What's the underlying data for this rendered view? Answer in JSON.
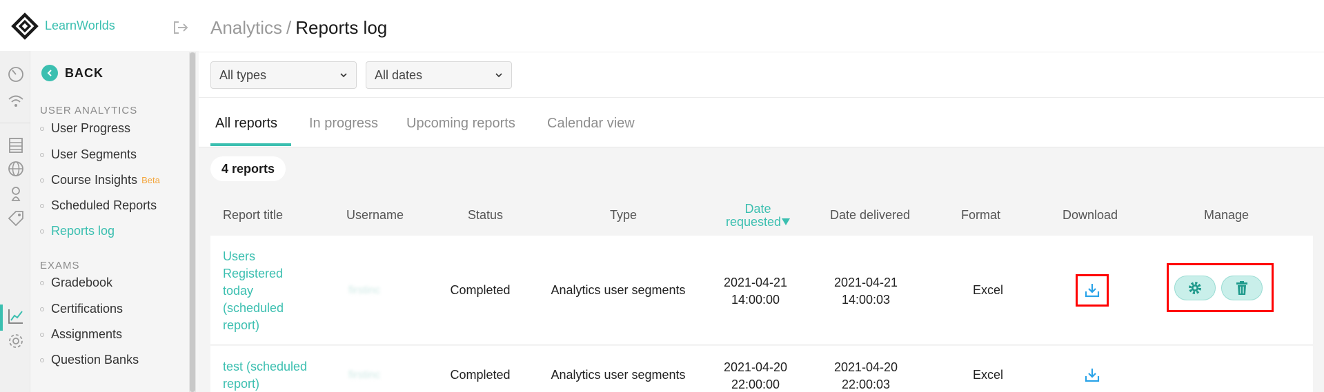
{
  "brand": {
    "name": "LearnWorlds",
    "accent": "#3bbfb0"
  },
  "sidebar": {
    "back_label": "BACK",
    "sections": [
      {
        "title": "USER ANALYTICS"
      },
      {
        "title": "EXAMS"
      }
    ],
    "items": [
      {
        "label": "User Progress"
      },
      {
        "label": "User Segments"
      },
      {
        "label": "Course Insights",
        "badge": "Beta"
      },
      {
        "label": "Scheduled Reports"
      },
      {
        "label": "Reports log"
      },
      {
        "label": "Gradebook"
      },
      {
        "label": "Certifications"
      },
      {
        "label": "Assignments"
      },
      {
        "label": "Question Banks"
      }
    ],
    "rail_icons": [
      "speedometer-icon",
      "wifi-icon",
      "document-icon",
      "globe-icon",
      "user-badge-icon",
      "tag-icon",
      "analytics-chart-icon",
      "gear-icon"
    ]
  },
  "header": {
    "parent": "Analytics",
    "separator": "/",
    "current": "Reports log"
  },
  "filters": {
    "type_value": "All types",
    "date_value": "All dates"
  },
  "tabs": [
    {
      "label": "All reports"
    },
    {
      "label": "In progress"
    },
    {
      "label": "Upcoming reports"
    },
    {
      "label": "Calendar view"
    }
  ],
  "count_label": "4 reports",
  "table": {
    "headers": {
      "title": "Report title",
      "username": "Username",
      "status": "Status",
      "type": "Type",
      "date_requested_line1": "Date",
      "date_requested_line2": "requested",
      "date_delivered": "Date delivered",
      "format": "Format",
      "download": "Download",
      "manage": "Manage"
    },
    "rows": [
      {
        "title": "Users Registered today (scheduled report)",
        "username": "firstinc",
        "status": "Completed",
        "type": "Analytics user segments",
        "requested_date": "2021-04-21",
        "requested_time": "14:00:00",
        "delivered_date": "2021-04-21",
        "delivered_time": "14:00:03",
        "format": "Excel"
      },
      {
        "title": "test (scheduled report)",
        "username": "firstinc",
        "status": "Completed",
        "type": "Analytics user segments",
        "requested_date": "2021-04-20",
        "requested_time": "22:00:00",
        "delivered_date": "2021-04-20",
        "delivered_time": "22:00:03",
        "format": "Excel"
      }
    ]
  }
}
